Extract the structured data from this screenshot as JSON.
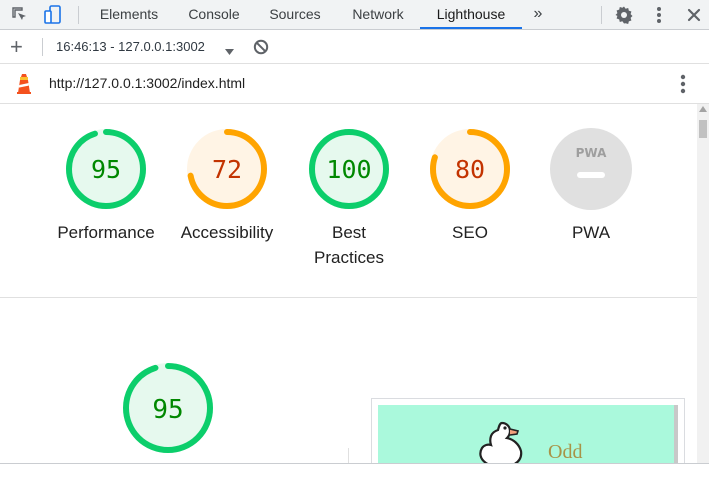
{
  "devtools": {
    "tabs": [
      {
        "label": "Elements"
      },
      {
        "label": "Console"
      },
      {
        "label": "Sources"
      },
      {
        "label": "Network"
      },
      {
        "label": "Lighthouse"
      }
    ],
    "more_tabs": "»",
    "active_tab": "Lighthouse"
  },
  "toolbar": {
    "new_report_label": "+",
    "report_selector": "16:46:13 - 127.0.0.1:3002"
  },
  "report": {
    "url": "http://127.0.0.1:3002/index.html",
    "gauges": [
      {
        "score": "95",
        "score_value": 95,
        "label": "Performance",
        "status": "pass"
      },
      {
        "score": "72",
        "score_value": 72,
        "label": "Accessibility",
        "status": "average"
      },
      {
        "score": "100",
        "score_value": 100,
        "label": "Best Practices",
        "status": "pass"
      },
      {
        "score": "80",
        "score_value": 80,
        "label": "SEO",
        "status": "average"
      },
      {
        "score": "",
        "score_value": null,
        "label": "PWA",
        "status": "pwa",
        "badge_text": "PWA"
      }
    ],
    "performance_section": {
      "score": "95",
      "score_value": 95
    },
    "screenshot": {
      "title": "Odd"
    }
  },
  "colors": {
    "pass": "#0cce6b",
    "pass_text": "#008800",
    "pass_bg": "#e6f9ee",
    "average": "#ffa400",
    "average_text": "#c33300",
    "average_bg": "#fff4e5",
    "pwa_bg": "#e0e0e0",
    "accent": "#1a73e8",
    "lighthouse": "#f4511e"
  }
}
